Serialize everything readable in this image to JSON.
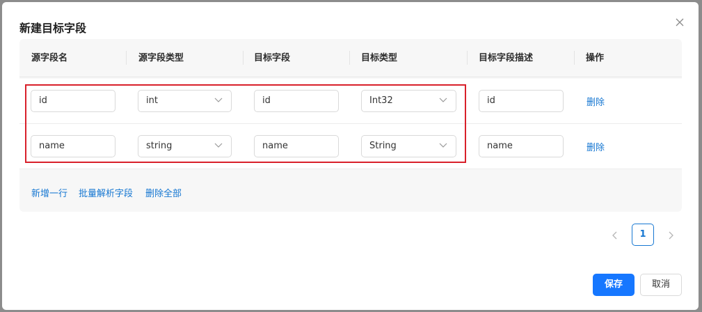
{
  "dialog": {
    "title": "新建目标字段",
    "close_icon": "close-icon"
  },
  "table": {
    "headers": [
      "源字段名",
      "源字段类型",
      "目标字段",
      "目标类型",
      "目标字段描述",
      "操作"
    ],
    "rows": [
      {
        "source_name": "id",
        "source_type": "int",
        "target_field": "id",
        "target_type": "Int32",
        "target_desc": "id",
        "action": "删除"
      },
      {
        "source_name": "name",
        "source_type": "string",
        "target_field": "name",
        "target_type": "String",
        "target_desc": "name",
        "action": "删除"
      }
    ],
    "footer_links": {
      "add_row": "新增一行",
      "batch_parse": "批量解析字段",
      "delete_all": "删除全部"
    }
  },
  "pagination": {
    "current_page": "1"
  },
  "footer": {
    "save_label": "保存",
    "cancel_label": "取消"
  },
  "colors": {
    "accent": "#1677ff",
    "highlight_border": "#d8202a"
  }
}
